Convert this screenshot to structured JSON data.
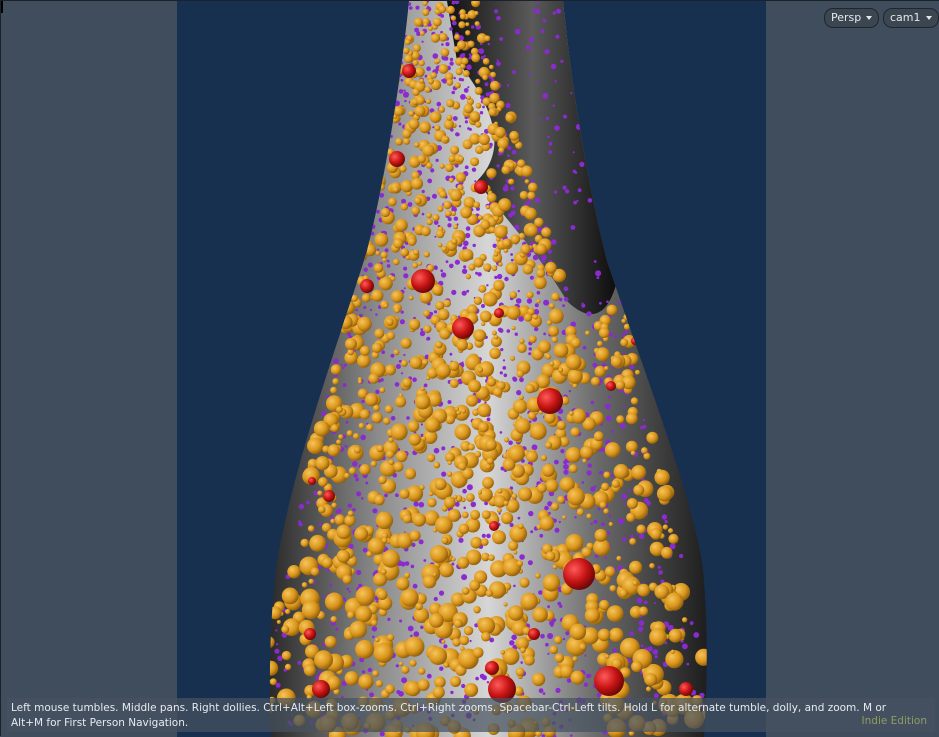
{
  "viewport": {
    "projection_label": "Persp",
    "camera_label": "cam1",
    "hint_text": "Left mouse tumbles. Middle pans. Right dollies. Ctrl+Alt+Left box-zooms. Ctrl+Right zooms. Spacebar-Ctrl-Left tilts. Hold L for alternate tumble, dolly, and zoom.     M or Alt+M for First Person Navigation.",
    "edition_label": "Indie Edition"
  },
  "colors": {
    "background": "#3f4d5d",
    "camera_background": "#17304f",
    "orange_spheres": "#e3a11f",
    "purple_spheres": "#8a2bd0",
    "red_spheres": "#c81414",
    "bottle_dark": "#1a1a1a",
    "bottle_light": "#d9d9d9"
  },
  "icons": {
    "dropdown": "chevron-down-icon"
  }
}
